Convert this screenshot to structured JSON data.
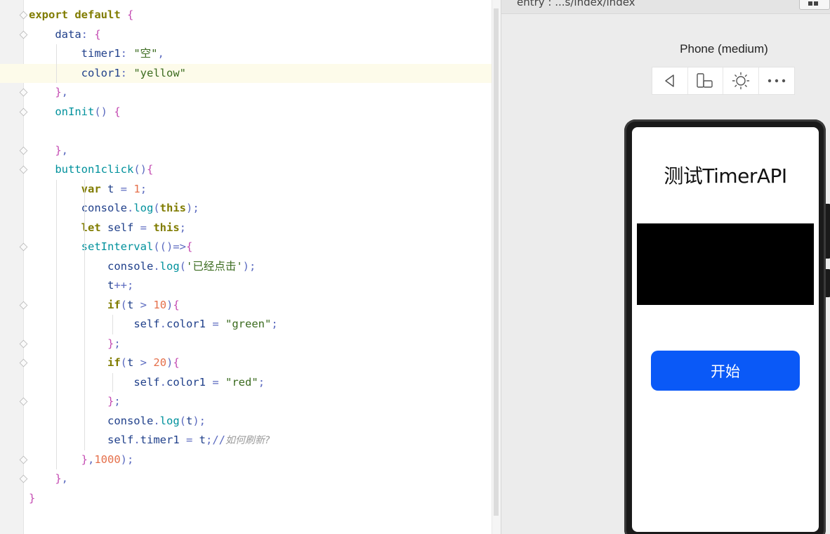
{
  "editor": {
    "lines": [
      [
        [
          "kw",
          "export"
        ],
        [
          "p",
          " "
        ],
        [
          "kw",
          "default"
        ],
        [
          "p",
          " "
        ],
        [
          "br",
          "{"
        ]
      ],
      [
        [
          "p",
          "    "
        ],
        [
          "prop",
          "data"
        ],
        [
          "op",
          ":"
        ],
        [
          "p",
          " "
        ],
        [
          "br",
          "{"
        ]
      ],
      [
        [
          "p",
          "        "
        ],
        [
          "prop",
          "timer1"
        ],
        [
          "op",
          ":"
        ],
        [
          "p",
          " "
        ],
        [
          "str",
          "\"空\""
        ],
        [
          "op",
          ","
        ]
      ],
      [
        [
          "p",
          "        "
        ],
        [
          "prop",
          "color1"
        ],
        [
          "op",
          ":"
        ],
        [
          "p",
          " "
        ],
        [
          "str",
          "\"yellow\""
        ]
      ],
      [
        [
          "p",
          "    "
        ],
        [
          "br",
          "}"
        ],
        [
          "op",
          ","
        ]
      ],
      [
        [
          "p",
          "    "
        ],
        [
          "fn",
          "onInit"
        ],
        [
          "op",
          "()"
        ],
        [
          "p",
          " "
        ],
        [
          "br",
          "{"
        ]
      ],
      [
        [
          "p",
          ""
        ]
      ],
      [
        [
          "p",
          "    "
        ],
        [
          "br",
          "}"
        ],
        [
          "op",
          ","
        ]
      ],
      [
        [
          "p",
          "    "
        ],
        [
          "fn",
          "button1click"
        ],
        [
          "op",
          "()"
        ],
        [
          "br",
          "{"
        ]
      ],
      [
        [
          "p",
          "        "
        ],
        [
          "kw",
          "var"
        ],
        [
          "p",
          " t "
        ],
        [
          "op",
          "="
        ],
        [
          "p",
          " "
        ],
        [
          "num",
          "1"
        ],
        [
          "op",
          ";"
        ]
      ],
      [
        [
          "p",
          "        "
        ],
        [
          "prop",
          "console"
        ],
        [
          "op",
          "."
        ],
        [
          "fn",
          "log"
        ],
        [
          "op",
          "("
        ],
        [
          "kw",
          "this"
        ],
        [
          "op",
          ");"
        ]
      ],
      [
        [
          "p",
          "        "
        ],
        [
          "kw",
          "let"
        ],
        [
          "p",
          " self "
        ],
        [
          "op",
          "="
        ],
        [
          "p",
          " "
        ],
        [
          "kw",
          "this"
        ],
        [
          "op",
          ";"
        ]
      ],
      [
        [
          "p",
          "        "
        ],
        [
          "fn",
          "setInterval"
        ],
        [
          "op",
          "(()=>"
        ],
        [
          "br",
          "{"
        ]
      ],
      [
        [
          "p",
          "            "
        ],
        [
          "prop",
          "console"
        ],
        [
          "op",
          "."
        ],
        [
          "fn",
          "log"
        ],
        [
          "op",
          "("
        ],
        [
          "str",
          "'已经点击'"
        ],
        [
          "op",
          ");"
        ]
      ],
      [
        [
          "p",
          "            "
        ],
        [
          "prop",
          "t"
        ],
        [
          "op",
          "++;"
        ]
      ],
      [
        [
          "p",
          "            "
        ],
        [
          "kw",
          "if"
        ],
        [
          "op",
          "("
        ],
        [
          "p",
          "t "
        ],
        [
          "op",
          ">"
        ],
        [
          "p",
          " "
        ],
        [
          "num",
          "10"
        ],
        [
          "op",
          ")"
        ],
        [
          "br",
          "{"
        ]
      ],
      [
        [
          "p",
          "                "
        ],
        [
          "prop",
          "self"
        ],
        [
          "op",
          "."
        ],
        [
          "prop",
          "color1"
        ],
        [
          "p",
          " "
        ],
        [
          "op",
          "="
        ],
        [
          "p",
          " "
        ],
        [
          "str",
          "\"green\""
        ],
        [
          "op",
          ";"
        ]
      ],
      [
        [
          "p",
          "            "
        ],
        [
          "br",
          "}"
        ],
        [
          "op",
          ";"
        ]
      ],
      [
        [
          "p",
          "            "
        ],
        [
          "kw",
          "if"
        ],
        [
          "op",
          "("
        ],
        [
          "p",
          "t "
        ],
        [
          "op",
          ">"
        ],
        [
          "p",
          " "
        ],
        [
          "num",
          "20"
        ],
        [
          "op",
          ")"
        ],
        [
          "br",
          "{"
        ]
      ],
      [
        [
          "p",
          "                "
        ],
        [
          "prop",
          "self"
        ],
        [
          "op",
          "."
        ],
        [
          "prop",
          "color1"
        ],
        [
          "p",
          " "
        ],
        [
          "op",
          "="
        ],
        [
          "p",
          " "
        ],
        [
          "str",
          "\"red\""
        ],
        [
          "op",
          ";"
        ]
      ],
      [
        [
          "p",
          "            "
        ],
        [
          "br",
          "}"
        ],
        [
          "op",
          ";"
        ]
      ],
      [
        [
          "p",
          "            "
        ],
        [
          "prop",
          "console"
        ],
        [
          "op",
          "."
        ],
        [
          "fn",
          "log"
        ],
        [
          "op",
          "("
        ],
        [
          "p",
          "t"
        ],
        [
          "op",
          ");"
        ]
      ],
      [
        [
          "p",
          "            "
        ],
        [
          "prop",
          "self"
        ],
        [
          "op",
          "."
        ],
        [
          "prop",
          "timer1"
        ],
        [
          "p",
          " "
        ],
        [
          "op",
          "="
        ],
        [
          "p",
          " t"
        ],
        [
          "op",
          ";//"
        ],
        [
          "cm",
          "如何刷新?"
        ]
      ],
      [
        [
          "p",
          "        "
        ],
        [
          "br",
          "}"
        ],
        [
          "op",
          ","
        ],
        [
          "num",
          "1000"
        ],
        [
          "op",
          ");"
        ]
      ],
      [
        [
          "p",
          "    "
        ],
        [
          "br",
          "}"
        ],
        [
          "op",
          ","
        ]
      ],
      [
        [
          "br",
          "}"
        ]
      ]
    ],
    "active_line": 3
  },
  "preview": {
    "entry_label": "entry : ...s/index/index",
    "device_name": "Phone (medium)",
    "toolbar_icons": [
      "back-icon",
      "rotate-device-icon",
      "theme-light-icon",
      "more-icon"
    ]
  },
  "app": {
    "title": "测试TimerAPI",
    "button_label": "开始",
    "accent_color": "#0a59f7",
    "display_box_color": "#000000"
  }
}
